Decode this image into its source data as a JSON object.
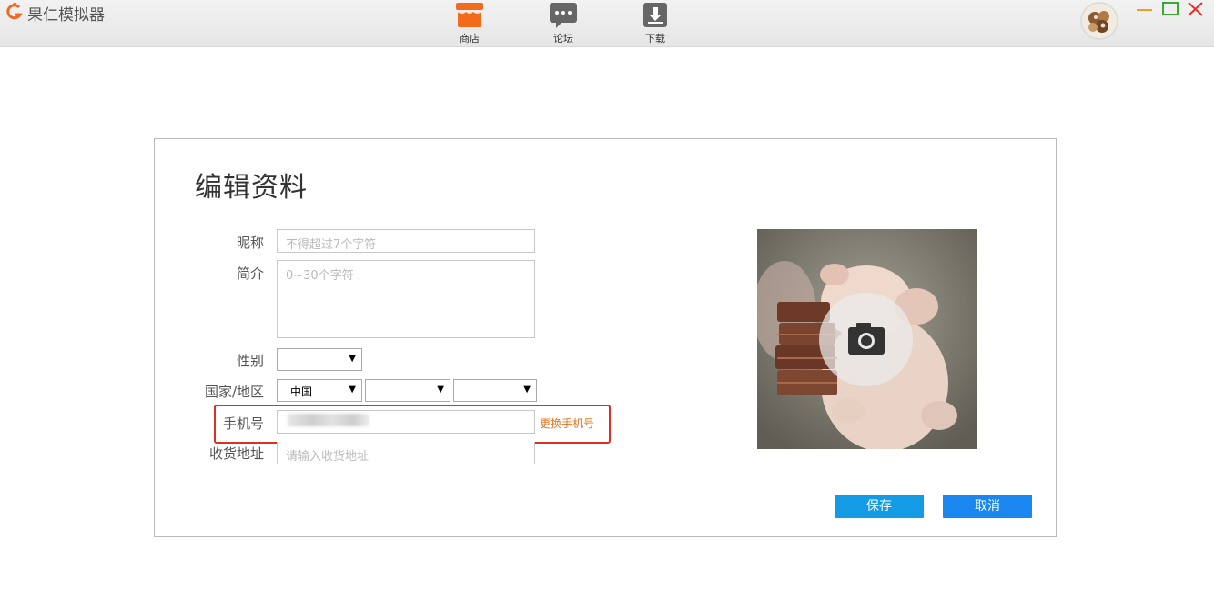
{
  "app": {
    "title": "果仁模拟器"
  },
  "nav": {
    "items": [
      {
        "label": "商店",
        "icon": "store-icon"
      },
      {
        "label": "论坛",
        "icon": "forum-chat-icon"
      },
      {
        "label": "下载",
        "icon": "download-icon"
      }
    ]
  },
  "colors": {
    "accent_orange": "#f26b1d",
    "save_button": "#139be6",
    "cancel_button": "#1a86f0",
    "highlight_border": "#d9302a",
    "link_orange": "#e8741f"
  },
  "dialog": {
    "title": "编辑资料",
    "fields": {
      "nickname": {
        "label": "昵称",
        "placeholder": "不得超过7个字符",
        "value": ""
      },
      "bio": {
        "label": "简介",
        "placeholder": "0~30个字符",
        "value": ""
      },
      "gender": {
        "label": "性别",
        "selected": ""
      },
      "region": {
        "label": "国家/地区",
        "country": "中国",
        "province": "",
        "city": ""
      },
      "phone": {
        "label": "手机号",
        "value": "",
        "change_link": "更换手机号"
      },
      "address": {
        "label": "收货地址",
        "placeholder": "请输入收货地址",
        "value": ""
      }
    },
    "avatar": {
      "icon": "camera-icon"
    },
    "buttons": {
      "save": "保存",
      "cancel": "取消"
    }
  }
}
